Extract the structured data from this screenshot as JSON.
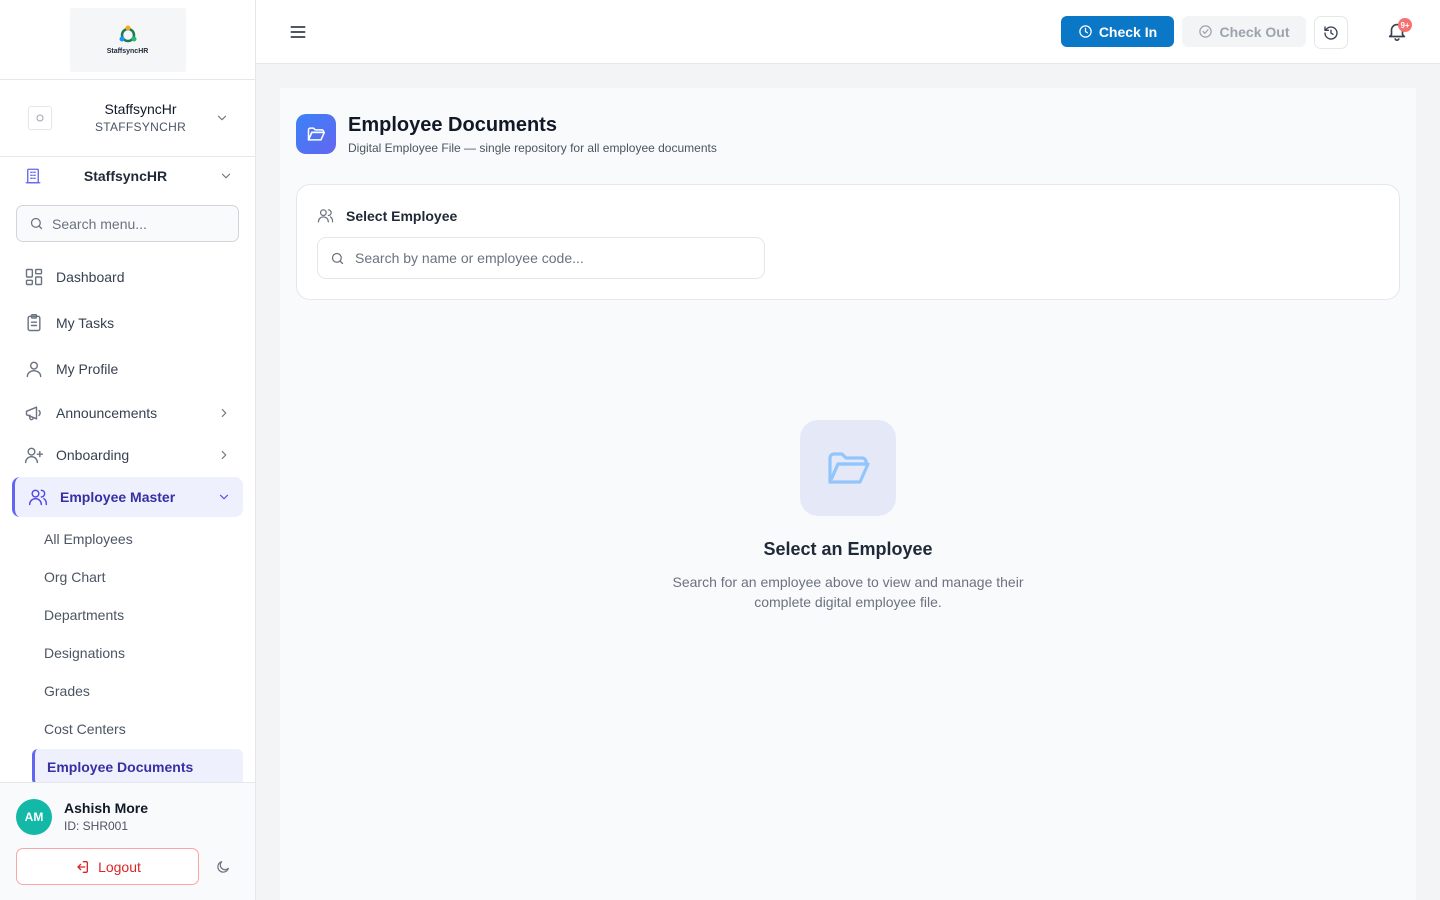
{
  "logo": {
    "text": "StaffsyncHR"
  },
  "org": {
    "name": "StaffsyncHr",
    "code": "STAFFSYNCHR"
  },
  "company": {
    "name": "StaffsyncHR"
  },
  "sidebar_search": {
    "placeholder": "Search menu..."
  },
  "menu": {
    "dashboard": "Dashboard",
    "tasks": "My Tasks",
    "profile": "My Profile",
    "announcements": "Announcements",
    "onboarding": "Onboarding",
    "employee_master": "Employee Master",
    "sub": [
      "All Employees",
      "Org Chart",
      "Departments",
      "Designations",
      "Grades",
      "Cost Centers",
      "Employee Documents"
    ]
  },
  "user": {
    "initials": "AM",
    "name": "Ashish More",
    "id": "ID: SHR001"
  },
  "logout": {
    "label": "Logout"
  },
  "topbar": {
    "checkin": "Check In",
    "checkout": "Check Out",
    "badge": "9+"
  },
  "page": {
    "title": "Employee Documents",
    "subtitle": "Digital Employee File — single repository for all employee documents"
  },
  "select_card": {
    "heading": "Select Employee",
    "placeholder": "Search by name or employee code..."
  },
  "empty": {
    "title": "Select an Employee",
    "description": "Search for an employee above to view and manage their complete digital employee file."
  },
  "colors": {
    "accent": "#6366f1",
    "primary_button": "#0a78c7",
    "avatar": "#14b8a6",
    "danger": "#dc2626"
  }
}
